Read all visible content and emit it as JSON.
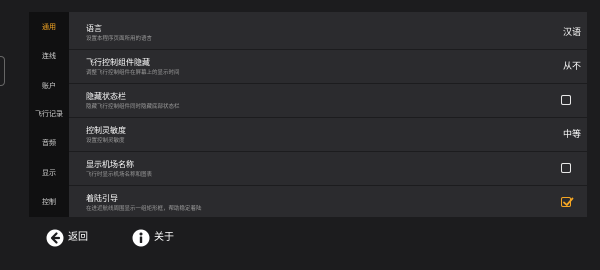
{
  "sidebar": {
    "items": [
      {
        "label": "通用",
        "active": true
      },
      {
        "label": "连线",
        "active": false
      },
      {
        "label": "账户",
        "active": false
      },
      {
        "label": "飞行记录",
        "active": false
      },
      {
        "label": "音频",
        "active": false
      },
      {
        "label": "显示",
        "active": false
      },
      {
        "label": "控制",
        "active": false
      }
    ]
  },
  "settings": [
    {
      "title": "语言",
      "subtitle": "设置本程序页面所用的语言",
      "value": "汉语",
      "control": "value"
    },
    {
      "title": "飞行控制组件隐藏",
      "subtitle": "调整飞行控制组件在屏幕上的显示时间",
      "value": "从不",
      "control": "value"
    },
    {
      "title": "隐藏状态栏",
      "subtitle": "隐藏飞行控制组件同时隐藏底部状态栏",
      "checked": false,
      "control": "checkbox"
    },
    {
      "title": "控制灵敏度",
      "subtitle": "设置控制灵敏度",
      "value": "中等",
      "control": "value"
    },
    {
      "title": "显示机场名称",
      "subtitle": "飞行时显示机场名称和图表",
      "checked": false,
      "control": "checkbox"
    },
    {
      "title": "着陆引导",
      "subtitle": "在进近航线周围显示一组矩形框，帮助稳定着陆",
      "checked": true,
      "control": "checkbox"
    }
  ],
  "footer": {
    "back_label": "返回",
    "about_label": "关于"
  },
  "colors": {
    "accent": "#f5a623",
    "background": "#1c1c1e",
    "panel": "#2b2b2e",
    "sidebar": "#101011"
  },
  "icons": {
    "back": "arrow-left-circle-icon",
    "about": "info-icon"
  }
}
